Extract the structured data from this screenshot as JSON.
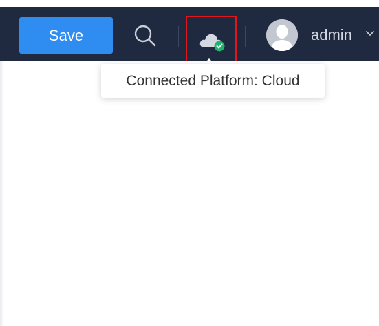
{
  "toolbar": {
    "save_label": "Save",
    "search_icon": "search-icon",
    "platform_icon": "cloud-check-icon",
    "avatar_icon": "user-avatar-icon",
    "user_name": "admin",
    "dropdown_icon": "chevron-down-icon"
  },
  "tooltip": {
    "text": "Connected Platform: Cloud"
  },
  "colors": {
    "topbar": "#1f2a40",
    "save_button": "#2f8cf1",
    "highlight_border": "#e0161b",
    "connected_badge": "#1fb36b"
  }
}
